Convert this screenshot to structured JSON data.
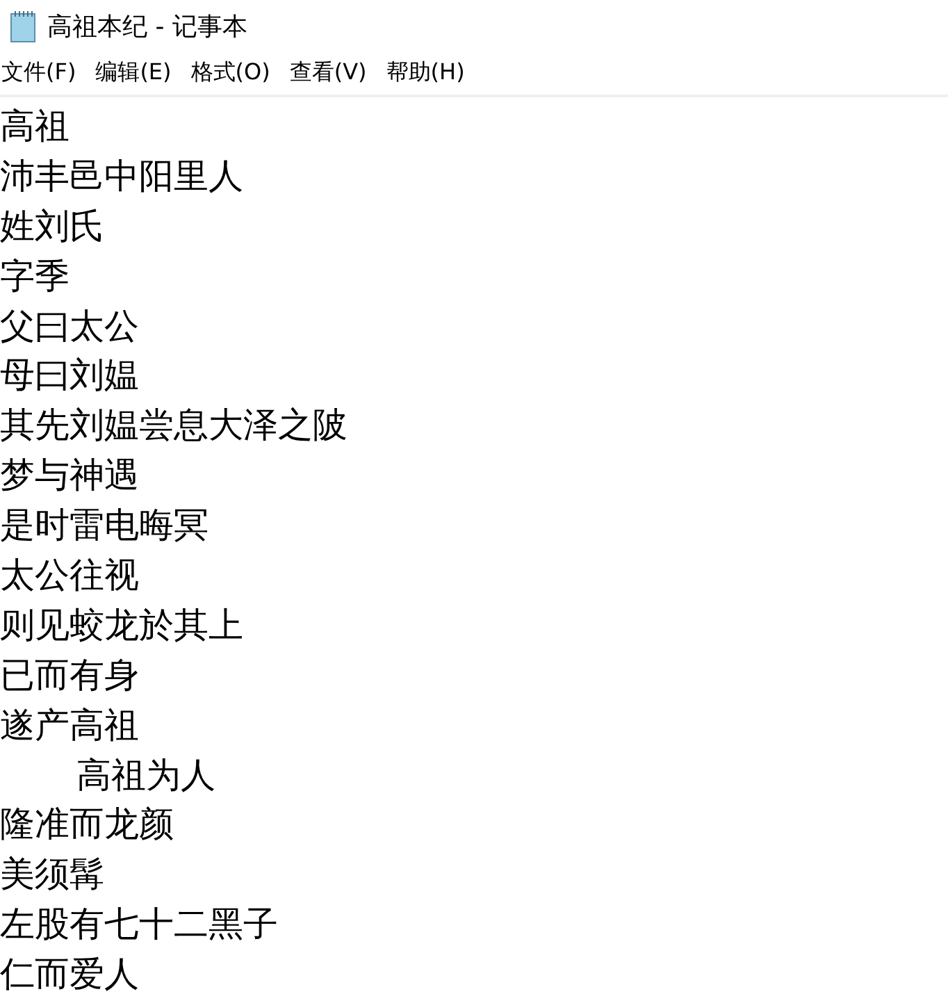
{
  "window": {
    "title": "高祖本纪 - 记事本"
  },
  "menu": [
    "文件(F)",
    "编辑(E)",
    "格式(O)",
    "查看(V)",
    "帮助(H)"
  ],
  "lines": [
    "高祖",
    "沛丰邑中阳里人",
    "姓刘氏",
    "字季",
    "父曰太公",
    "母曰刘媪",
    "其先刘媪尝息大泽之陂",
    "梦与神遇",
    "是时雷电晦冥",
    "太公往视",
    "则见蛟龙於其上",
    "已而有身",
    "遂产高祖",
    "\t高祖为人",
    "隆准而龙颜",
    "美须髯",
    "左股有七十二黑子",
    "仁而爱人"
  ]
}
